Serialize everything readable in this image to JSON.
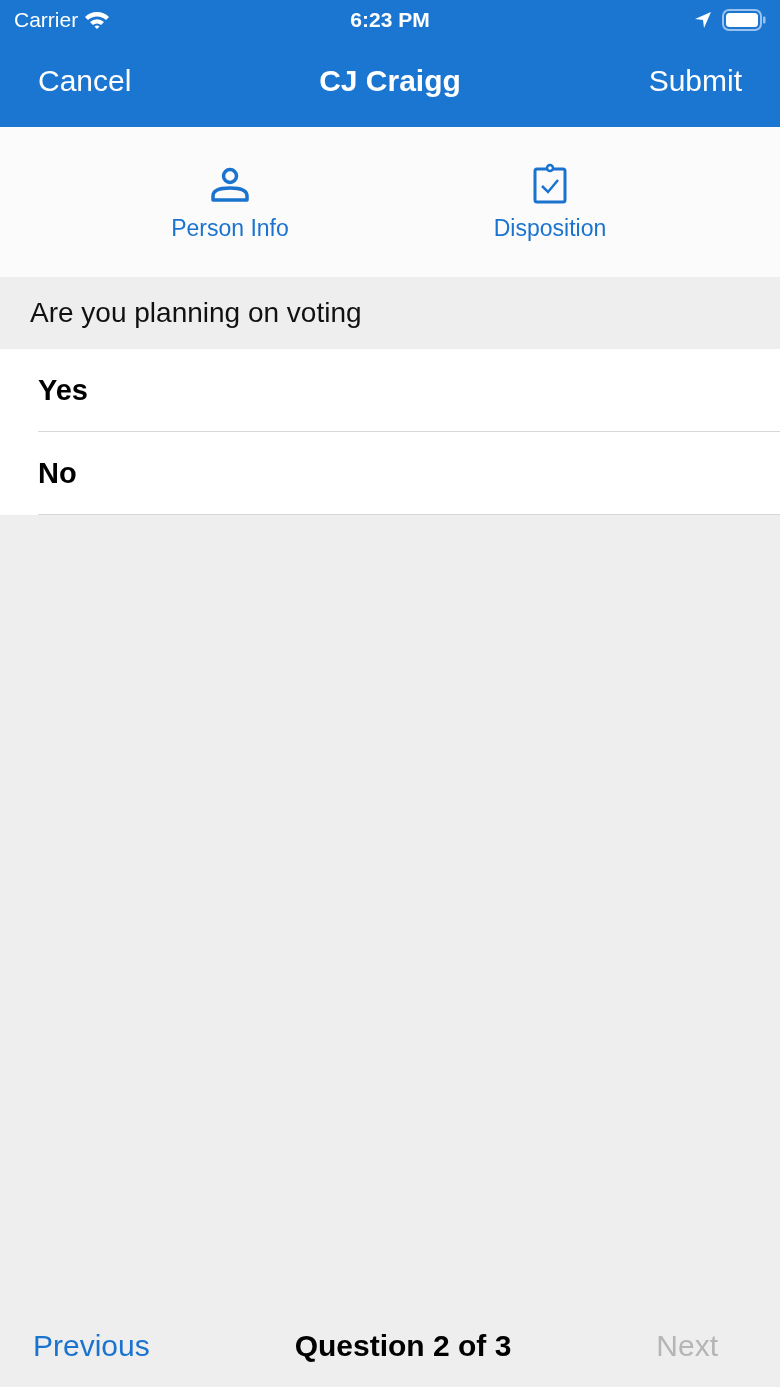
{
  "status_bar": {
    "carrier": "Carrier",
    "time": "6:23 PM"
  },
  "nav_bar": {
    "left": "Cancel",
    "title": "CJ Craigg",
    "right": "Submit"
  },
  "tabs": [
    {
      "label": "Person Info",
      "kind": "person"
    },
    {
      "label": "Disposition",
      "kind": "clipboard"
    }
  ],
  "question": {
    "text": "Are you planning on voting",
    "options": [
      {
        "label": "Yes"
      },
      {
        "label": "No"
      }
    ]
  },
  "footer": {
    "previous": {
      "label": "Previous",
      "disabled": false
    },
    "progress": "Question 2 of 3",
    "next": {
      "label": "Next",
      "disabled": true
    }
  }
}
